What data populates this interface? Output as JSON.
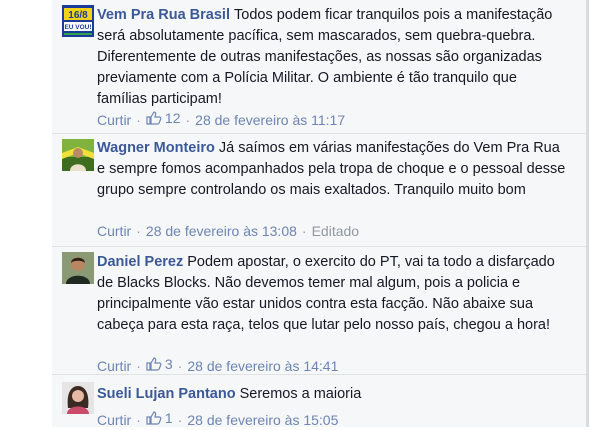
{
  "comments": [
    {
      "author": "Vem Pra Rua Brasil",
      "avatar_text": "16/8",
      "avatar_sub": "EU VOU!",
      "text": "Todos podem ficar tranquilos pois a manifestação será absolutamente pacífica, sem mascarados, sem quebra-quebra. Diferentemente de outras manifestações, as nossas são organizadas previamente com a Polícia Militar. O ambiente é tão tranquilo que famílias participam!",
      "reply_label": "Curtir",
      "likes": "12",
      "timestamp": "28 de fevereiro às 11:17"
    },
    {
      "author": "Wagner Monteiro",
      "text": "Já saímos em várias manifestações do Vem Pra Rua e sempre fomos acompanhados pela tropa de choque e o pessoal desse grupo sempre controlando os mais exaltados. Tranquilo muito bom",
      "reply_label": "Curtir",
      "timestamp": "28 de fevereiro às 13:08",
      "edited": "Editado"
    },
    {
      "author": "Daniel Perez",
      "text": "Podem apostar, o exercito do PT, vai ta todo a disfarçado de Blacks Blocks. Não devemos temer mal algum, pois a policia e principalmente vão estar unidos contra esta facção. Não abaixe sua cabeça para esta raça, telos que lutar pelo nosso país, chegou a hora!",
      "reply_label": "Curtir",
      "likes": "3",
      "timestamp": "28 de fevereiro às 14:41"
    },
    {
      "author": "Sueli Lujan Pantano",
      "text": "Seremos a maioria",
      "reply_label": "Curtir",
      "likes": "1",
      "timestamp": "28 de fevereiro às 15:05"
    }
  ],
  "separator": "·",
  "colors": {
    "link": "#3b5998",
    "meta": "#9197a3",
    "background": "#f6f7f9"
  }
}
